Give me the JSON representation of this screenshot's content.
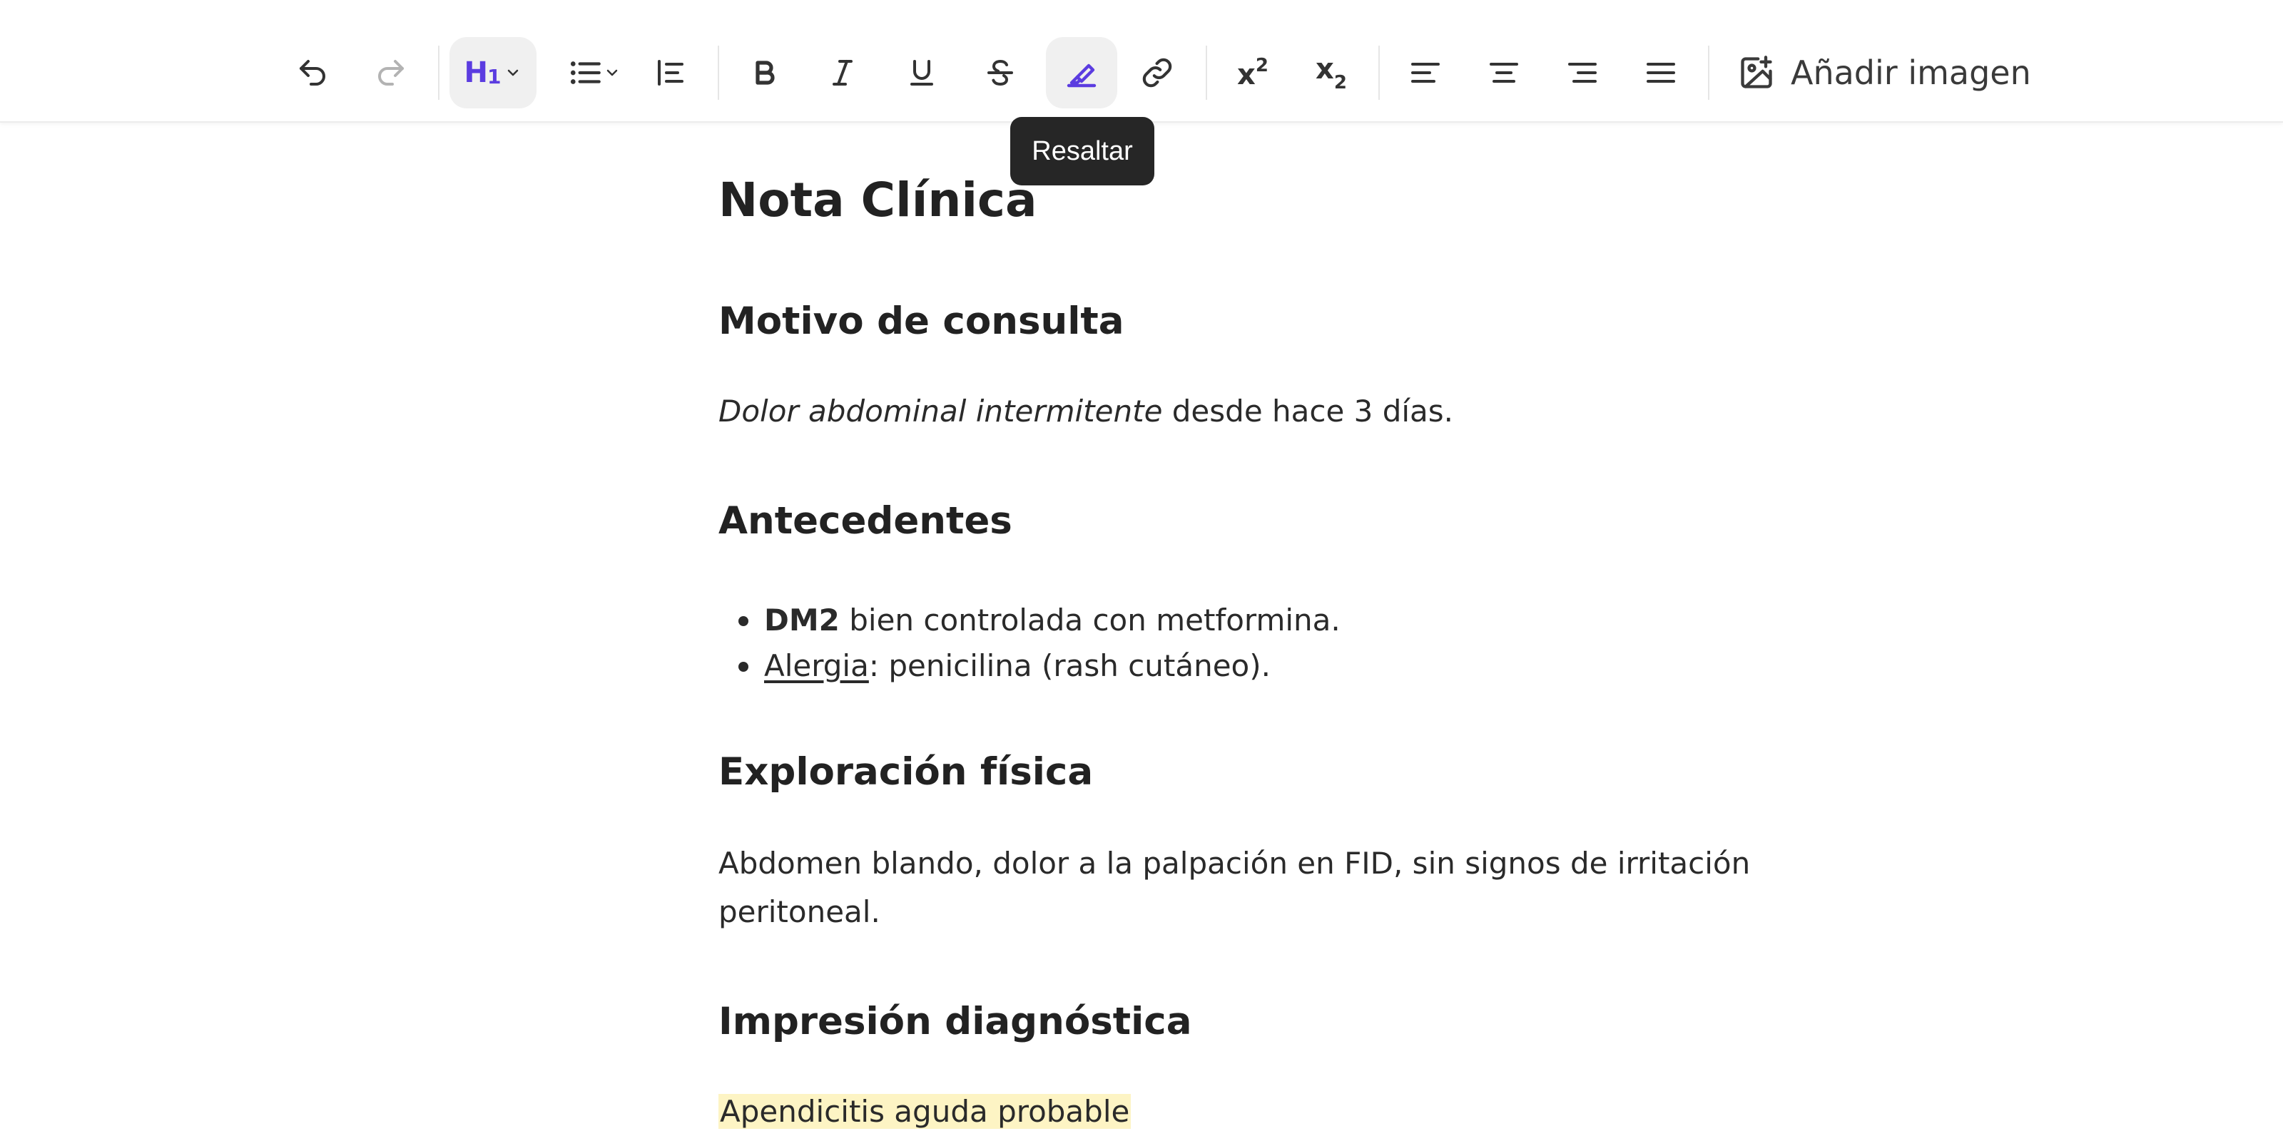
{
  "toolbar": {
    "undo": "undo-icon",
    "redo": "redo-icon",
    "heading": {
      "letter": "H",
      "level": "1"
    },
    "list": "bullet-list-icon",
    "blockquote": "blockquote-icon",
    "bold": "bold-icon",
    "italic": "italic-icon",
    "underline": "underline-icon",
    "strike": "strikethrough-icon",
    "highlight": "highlighter-icon",
    "link": "link-icon",
    "superscript": {
      "base": "x",
      "exp": "2"
    },
    "subscript": {
      "base": "x",
      "exp": "2"
    },
    "align": [
      "align-left-icon",
      "align-center-icon",
      "align-right-icon",
      "align-justify-icon"
    ],
    "add_image_label": "Añadir imagen",
    "accent_color": "#5b3ce0"
  },
  "tooltip": {
    "text": "Resaltar"
  },
  "document": {
    "title": "Nota Clínica",
    "sections": [
      {
        "heading": "Motivo de consulta"
      },
      {
        "heading": "Antecedentes"
      },
      {
        "heading": "Exploración física"
      },
      {
        "heading": "Impresión diagnóstica"
      }
    ],
    "motivo": {
      "italic": "Dolor abdominal intermitente",
      "rest": " desde hace 3 días."
    },
    "antecedentes": [
      {
        "bold": "DM2",
        "rest": " bien controlada con metformina."
      },
      {
        "underline": "Alergia",
        "rest": ": penicilina (rash cutáneo)."
      }
    ],
    "exploracion": {
      "line1": "Abdomen blando, dolor a la palpación en FID, sin signos de irritación",
      "line2": "peritoneal."
    },
    "impresion": {
      "highlighted": "Apendicitis aguda probable",
      "highlight_color": "#fdf4c4"
    }
  }
}
